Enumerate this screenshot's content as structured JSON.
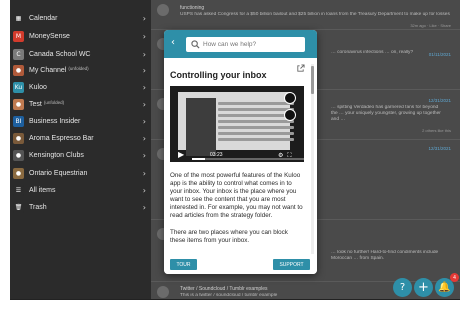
{
  "sidebar": {
    "items": [
      {
        "label": "Calendar",
        "sub": "",
        "icon": "calendar-icon",
        "icon_char": "▦",
        "color": "#2b2b2b"
      },
      {
        "label": "MoneySense",
        "sub": "",
        "icon": "moneysense-logo-icon",
        "icon_char": "M",
        "color": "#d33b2c"
      },
      {
        "label": "Canada School WC",
        "sub": "",
        "icon": "canada-school-icon",
        "icon_char": "C",
        "color": "#7a7a7a"
      },
      {
        "label": "My Channel",
        "sub": "(unfolded)",
        "icon": "my-channel-avatar-icon",
        "icon_char": "●",
        "color": "#b05a3a"
      },
      {
        "label": "Kuloo",
        "sub": "",
        "icon": "kuloo-logo-icon",
        "icon_char": "Ku",
        "color": "#2e8fa8"
      },
      {
        "label": "Test",
        "sub": "(unfolded)",
        "icon": "test-avatar-icon",
        "icon_char": "●",
        "color": "#c07a50"
      },
      {
        "label": "Business Insider",
        "sub": "",
        "icon": "business-insider-icon",
        "icon_char": "BI",
        "color": "#1d5f9e"
      },
      {
        "label": "Aroma Espresso Bar",
        "sub": "",
        "icon": "aroma-espresso-icon",
        "icon_char": "●",
        "color": "#7a5a3a"
      },
      {
        "label": "Kensington Clubs",
        "sub": "",
        "icon": "kensington-icon",
        "icon_char": "●",
        "color": "#555555"
      },
      {
        "label": "Ontario Equestrian",
        "sub": "",
        "icon": "ontario-equestrian-icon",
        "icon_char": "●",
        "color": "#8a6a40"
      },
      {
        "label": "All items",
        "sub": "",
        "icon": "all-items-icon",
        "icon_char": "☰",
        "color": "#2b2b2b"
      },
      {
        "label": "Trash",
        "sub": "",
        "icon": "trash-icon",
        "icon_char": "🗑",
        "color": "#2b2b2b"
      }
    ]
  },
  "feed": {
    "posts": [
      {
        "title": "functioning",
        "body": "USPS has asked Congress for a $50 billion bailout and $25 billion in loans from the Treasury Department to make up for losses",
        "date": "",
        "meta": "32m ago · Like · Share"
      },
      {
        "title": "",
        "body": "… coronavirus infections … on, really?",
        "date": "01/11/2021",
        "meta": ""
      },
      {
        "title": "",
        "body": "… spitting Verdadeo has garnered fans for beyond the … your uniquely youngster, growing up together and …",
        "date": "12/31/2021",
        "meta": "2 others like this"
      },
      {
        "title": "",
        "body": "",
        "date": "12/31/2021",
        "meta": ""
      },
      {
        "title": "",
        "body": "… look no further! Hard-to-find condiments include Moroccan … from Spain.",
        "date": "",
        "meta": ""
      },
      {
        "title": "Twitter / Soundcloud / Tumblr examples",
        "body": "This is a twitter / soundcloud / tumblr example",
        "date": "",
        "meta": ""
      }
    ]
  },
  "modal": {
    "search_placeholder": "How can we help?",
    "title": "Controlling your inbox",
    "video_time": "03:23",
    "video_progress": 0.12,
    "paragraphs": [
      "One of the most powerful features of the Kuloo app is the ability to control what comes in to your inbox. Your inbox is the place where you want to see the content that you are most interested in. For example, you may not want to read articles from the strategy folder.",
      "There are two places where you can block these items from your inbox."
    ],
    "tour_label": "TOUR",
    "support_label": "SUPPORT"
  },
  "fabs": {
    "help_icon": "question-icon",
    "add_icon": "plus-icon",
    "bell_icon": "bell-icon",
    "badge_count": "4"
  },
  "colors": {
    "accent": "#2e8fa8",
    "sidebar_bg": "#2b2b2b",
    "badge": "#e53935"
  }
}
